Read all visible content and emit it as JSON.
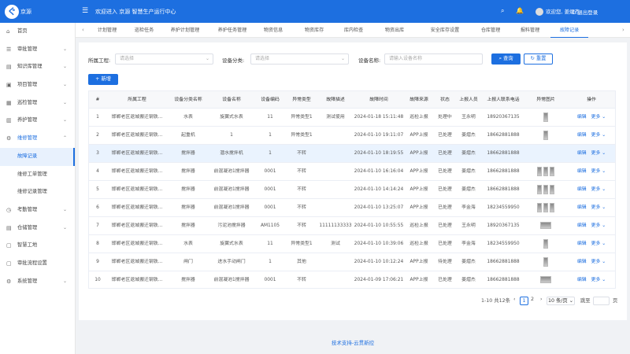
{
  "header": {
    "logo_mark": "ぐ",
    "logo_text": "京源",
    "menu_icon": "☰",
    "welcome": "欢迎进入 京源 智慧生产运行中心",
    "icons": [
      "search-icon",
      "bell-icon",
      "expand-icon"
    ],
    "icon_glyphs": [
      "⌕",
      "🔔",
      "⤢"
    ],
    "user_name": "欢迎您, 姜熠杰",
    "logout": "⏻ 退出登录"
  },
  "sidebar": {
    "items": [
      {
        "label": "首页",
        "icon": "⌂"
      },
      {
        "label": "审批管理",
        "icon": "☰",
        "arrow": "⌄"
      },
      {
        "label": "知识库管理",
        "icon": "▤",
        "arrow": "⌄"
      },
      {
        "label": "项目管理",
        "icon": "▣",
        "arrow": "⌄"
      },
      {
        "label": "巡检管理",
        "icon": "▦",
        "arrow": "⌄"
      },
      {
        "label": "养护管理",
        "icon": "▥",
        "arrow": "⌄"
      },
      {
        "label": "维修管理",
        "icon": "⚙",
        "arrow": "⌃"
      },
      {
        "label": "故障记录",
        "icon": ""
      },
      {
        "label": "维修工单管理",
        "icon": ""
      },
      {
        "label": "维修记录管理",
        "icon": ""
      },
      {
        "label": "考勤管理",
        "icon": "◷",
        "arrow": "⌄"
      },
      {
        "label": "仓储管理",
        "icon": "▤",
        "arrow": "⌄"
      },
      {
        "label": "智慧工地",
        "icon": "▢"
      },
      {
        "label": "审批流程设置",
        "icon": "▢"
      },
      {
        "label": "系统管理",
        "icon": "⚙",
        "arrow": "⌄"
      }
    ]
  },
  "tabs": {
    "prev": "‹",
    "next": "›",
    "items": [
      "计划管理",
      "巡检任务",
      "养护计划管理",
      "养护任务管理",
      "物资信息",
      "物资库存",
      "库内检查",
      "物资出库",
      "安全库存设置",
      "仓库管理",
      "报料管理",
      "故障记录"
    ],
    "active_index": 11
  },
  "filters": {
    "project_label": "所属工程:",
    "project_placeholder": "请选择",
    "category_label": "设备分类:",
    "category_placeholder": "请选择",
    "name_label": "设备名称:",
    "name_placeholder": "请输入设备名称",
    "query": "⌕ 查询",
    "reset": "↻ 重置",
    "add": "+ 新增"
  },
  "table": {
    "headers": [
      "#",
      "所属工程",
      "设备分类名称",
      "设备名称",
      "设备编码",
      "异常类型",
      "故障描述",
      "故障时间",
      "故障来源",
      "状态",
      "上报人员",
      "上报人联系电话",
      "异常图片",
      "操作"
    ],
    "rows": [
      [
        "1",
        "邯郸老区退城搬迁钢铁...",
        "水表",
        "旋翼式水表",
        "11",
        "异常类型1",
        "测试使用",
        "2024-01-18 15:11:48",
        "巡检上报",
        "处理中",
        "王永明",
        "18920367135"
      ],
      [
        "2",
        "邯郸老区退城搬迁钢铁...",
        "起重机",
        "1",
        "1",
        "异常类型1",
        "",
        "2024-01-10 19:11:07",
        "APP上报",
        "已处理",
        "姜熠杰",
        "18662881888"
      ],
      [
        "3",
        "邯郸老区退城搬迁钢铁...",
        "搅拌器",
        "潜水搅拌机",
        "1",
        "不转",
        "",
        "2024-01-10 18:19:55",
        "APP上报",
        "已处理",
        "姜熠杰",
        "18662881888"
      ],
      [
        "4",
        "邯郸老区退城搬迁钢铁...",
        "搅拌器",
        "前混凝池1搅拌器",
        "0001",
        "不转",
        "",
        "2024-01-10 16:16:04",
        "APP上报",
        "已处理",
        "姜熠杰",
        "18662881888"
      ],
      [
        "5",
        "邯郸老区退城搬迁钢铁...",
        "搅拌器",
        "前混凝池1搅拌器",
        "0001",
        "不转",
        "",
        "2024-01-10 14:14:24",
        "APP上报",
        "已处理",
        "姜熠杰",
        "18662881888"
      ],
      [
        "6",
        "邯郸老区退城搬迁钢铁...",
        "搅拌器",
        "前混凝池1搅拌器",
        "0001",
        "不转",
        "",
        "2024-01-10 13:25:07",
        "APP上报",
        "已处理",
        "李金海",
        "18234559950"
      ],
      [
        "7",
        "邯郸老区退城搬迁钢铁...",
        "搅拌器",
        "污泥池搅拌器",
        "AM1105",
        "不转",
        "11111133333",
        "2024-01-10 10:55:55",
        "巡检上报",
        "已处理",
        "王永明",
        "18920367135"
      ],
      [
        "8",
        "邯郸老区退城搬迁钢铁...",
        "水表",
        "旋翼式水表",
        "11",
        "异常类型1",
        "测试",
        "2024-01-10 10:39:06",
        "巡检上报",
        "已处理",
        "李金海",
        "18234559950"
      ],
      [
        "9",
        "邯郸老区退城搬迁钢铁...",
        "闸门",
        "进水手动闸门",
        "1",
        "其他",
        "",
        "2024-01-10 10:12:24",
        "APP上报",
        "待处理",
        "姜熠杰",
        "18662881888"
      ],
      [
        "10",
        "邯郸老区退城搬迁钢铁...",
        "搅拌器",
        "前混凝池1搅拌器",
        "0001",
        "不转",
        "",
        "2024-01-09 17:06:21",
        "APP上报",
        "已处理",
        "姜熠杰",
        "18662881888"
      ]
    ],
    "edit": "编辑",
    "more": "更多 ⌄",
    "highlight_row": 2
  },
  "pagination": {
    "summary": "1-10 共12条",
    "prev": "‹",
    "pages": [
      "1",
      "2"
    ],
    "next": "›",
    "page_size": "10 条/页 ⌄",
    "goto_label": "跳至",
    "goto_suffix": "页"
  },
  "footer": {
    "text": "技术支持-云贯新控"
  }
}
